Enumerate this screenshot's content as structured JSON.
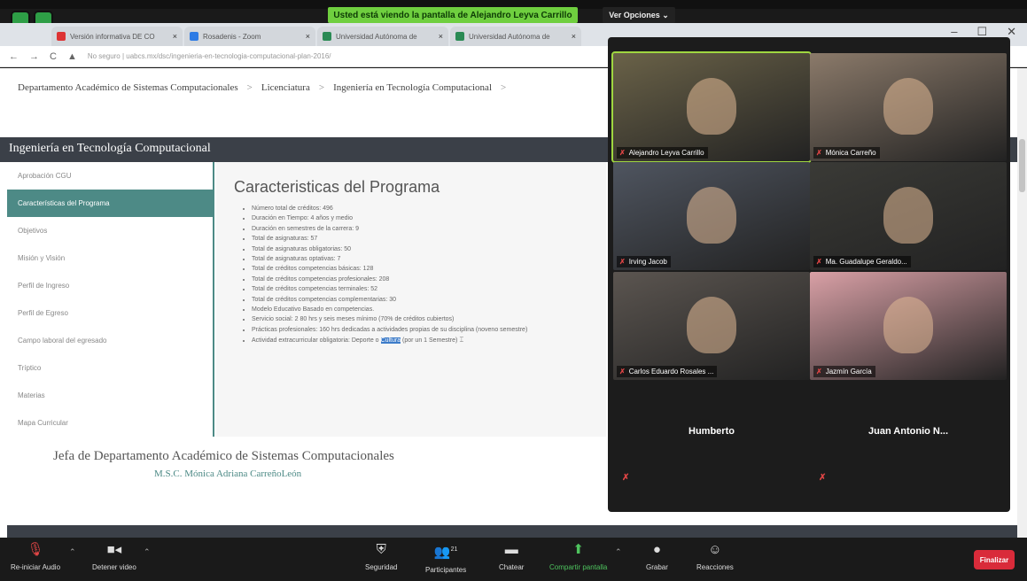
{
  "banner": {
    "share_text": "Usted está viendo la pantalla de Alejandro Leyva Carrillo",
    "view_options": "Ver Opciones ⌄"
  },
  "browser": {
    "tabs": [
      {
        "label": "Versión informativa DE CO",
        "color": "#d33"
      },
      {
        "label": "Rosadenis - Zoom",
        "color": "#2d7be5"
      },
      {
        "label": "Universidad Autónoma de",
        "color": "#2a8a54"
      },
      {
        "label": "Universidad Autónoma de",
        "color": "#2a8a54"
      }
    ],
    "url": "No seguro | uabcs.mx/dsc/ingenieria-en-tecnologia-computacional-plan-2016/"
  },
  "page": {
    "breadcrumb": [
      "Departamento Académico de Sistemas Computacionales",
      "Licenciatura",
      "Ingeniería en Tecnología Computacional"
    ],
    "section_title": "Ingeniería en Tecnología Computacional",
    "sidebar": [
      "Aprobación CGU",
      "Características del Programa",
      "Objetivos",
      "Misión y Visión",
      "Perfil de Ingreso",
      "Perfil de Egreso",
      "Campo laboral del egresado",
      "Tríptico",
      "Materias",
      "Mapa Curricular"
    ],
    "active_sidebar_index": 1,
    "content_title": "Caracteristicas del Programa",
    "features": [
      "Número total de créditos: 496",
      "Duración en Tiempo: 4 años y medio",
      "Duración en semestres de la carrera: 9",
      "Total de asignaturas: 57",
      "Total de asignaturas obligatorias: 50",
      "Total de asignaturas optativas: 7",
      "Total de créditos competencias básicas: 128",
      "Total de créditos competencias profesionales: 208",
      "Total de créditos competencias terminales: 52",
      "Total de créditos competencias complementarias: 30",
      "Modelo Educativo Basado en competencias.",
      "Servicio social: 2 80 hrs y seis meses mínimo (70% de créditos cubiertos)",
      "Prácticas profesionales: 160 hrs dedicadas a actividades propias de su disciplina (noveno semestre)"
    ],
    "last_feature": {
      "before": "Actividad extracurricular obligatoria: Deporte o ",
      "highlight": "Cultura",
      "after": " (por un 1 Semestre)"
    },
    "jefa_title": "Jefa de Departamento Académico de Sistemas Computacionales",
    "jefa_name": "M.S.C. Mónica Adriana CarreñoLeón"
  },
  "participants": [
    {
      "name": "Alejandro Leyva Carrillo",
      "bg": "#6a6248",
      "speaking": true
    },
    {
      "name": "Mónica Carreño",
      "bg": "#8b7a6a",
      "speaking": false
    },
    {
      "name": "Irving Jacob",
      "bg": "#4f5560",
      "speaking": false
    },
    {
      "name": "Ma. Guadalupe Geraldo...",
      "bg": "#3a3a36",
      "speaking": false
    },
    {
      "name": "Carlos Eduardo Rosales ...",
      "bg": "#5b5550",
      "speaking": false
    },
    {
      "name": "Jazmín García",
      "bg": "#d9a0a6",
      "speaking": false
    }
  ],
  "name_only_participants": [
    "Humberto",
    "Juan Antonio N..."
  ],
  "toolbar": {
    "unmute": "Re-iniciar Audio",
    "stop_video": "Detener video",
    "security": "Seguridad",
    "participants": "Participantes",
    "participants_count": "21",
    "chat": "Chatear",
    "share": "Compartir pantalla",
    "record": "Grabar",
    "reactions": "Reacciones",
    "end": "Finalizar"
  }
}
